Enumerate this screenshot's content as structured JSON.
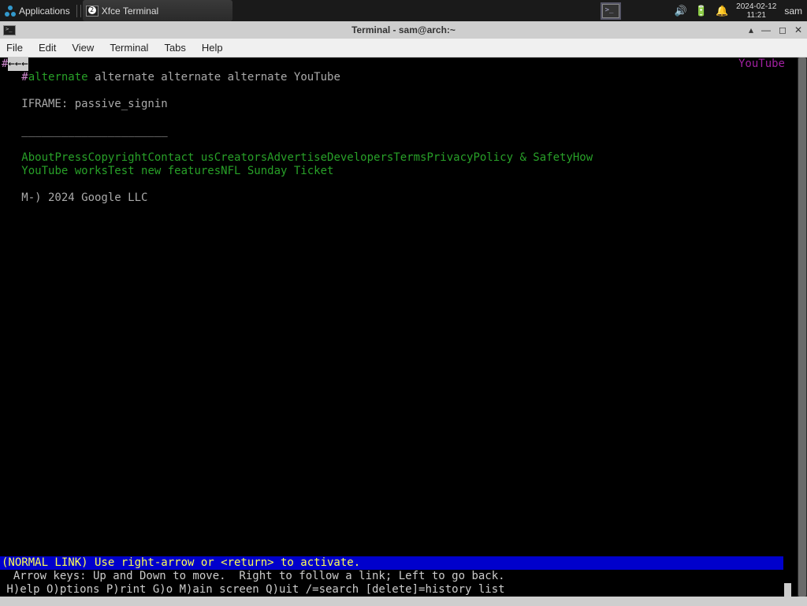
{
  "taskbar": {
    "apps_label": "Applications",
    "task_label": "Xfce Terminal",
    "date": "2024-02-12",
    "time": "11:21",
    "user": "sam"
  },
  "window": {
    "title": "Terminal - sam@arch:~"
  },
  "menubar": {
    "file": "File",
    "edit": "Edit",
    "view": "View",
    "terminal": "Terminal",
    "tabs": "Tabs",
    "help": "Help"
  },
  "content": {
    "left_arrows": "←←←",
    "hash": "#",
    "alt_first": "alternate",
    "alt_rest": " alternate alternate alternate YouTube",
    "yt_right": "YouTube",
    "iframe": "   IFRAME: passive_signin",
    "divider": "   ______________________",
    "links_line1": "AboutPressCopyrightContact usCreatorsAdvertiseDevelopersTermsPrivacyPolicy & SafetyHow",
    "links_line2": "YouTube worksTest new featuresNFL Sunday Ticket",
    "copyright": "   M-) 2024 Google LLC",
    "status": "(NORMAL LINK) Use right-arrow or <return> to activate.",
    "help1": "  Arrow keys: Up and Down to move.  Right to follow a link; Left to go back.",
    "help2": " H)elp O)ptions P)rint G)o M)ain screen Q)uit /=search [delete]=history list"
  }
}
